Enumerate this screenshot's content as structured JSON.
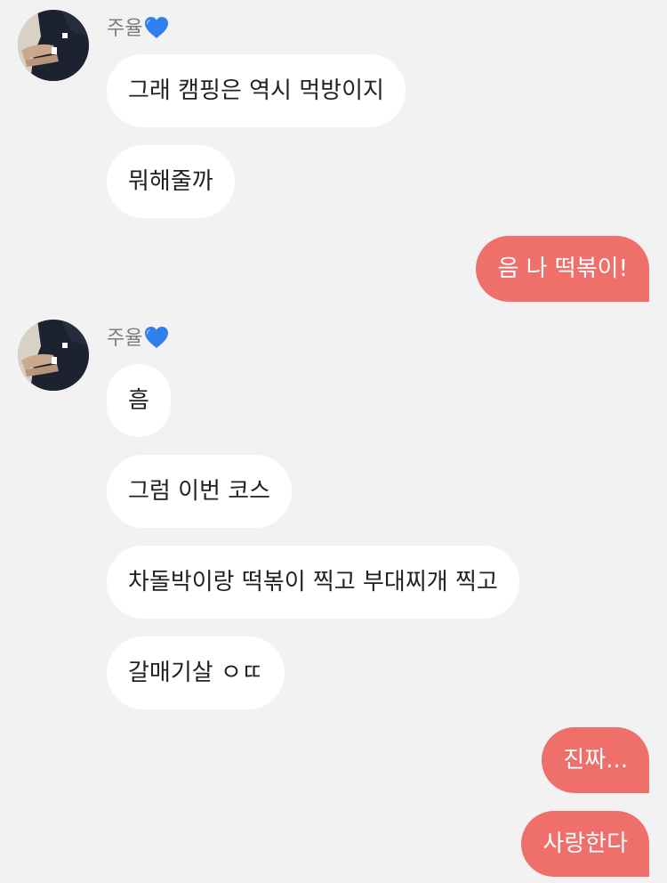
{
  "chat": {
    "sender_name": "주율",
    "sender_heart": "blue-heart-icon",
    "colors": {
      "background": "#f2f2f2",
      "incoming_bubble": "#ffffff",
      "outgoing_bubble": "#ef6f6b",
      "heart": "#2f80ec"
    },
    "messages": [
      {
        "from": "them",
        "text": "그래 캠핑은 역시 먹방이지"
      },
      {
        "from": "them",
        "text": "뭐해줄까"
      },
      {
        "from": "me",
        "text": "음 나 떡볶이!"
      },
      {
        "from": "them",
        "text": "흠"
      },
      {
        "from": "them",
        "text": "그럼 이번 코스"
      },
      {
        "from": "them",
        "text": "차돌박이랑 떡볶이 찍고 부대찌개 찍고"
      },
      {
        "from": "them",
        "text": "갈매기살 ㅇㄸ"
      },
      {
        "from": "me",
        "text": "진짜..."
      },
      {
        "from": "me",
        "text": "사랑한다"
      }
    ]
  }
}
